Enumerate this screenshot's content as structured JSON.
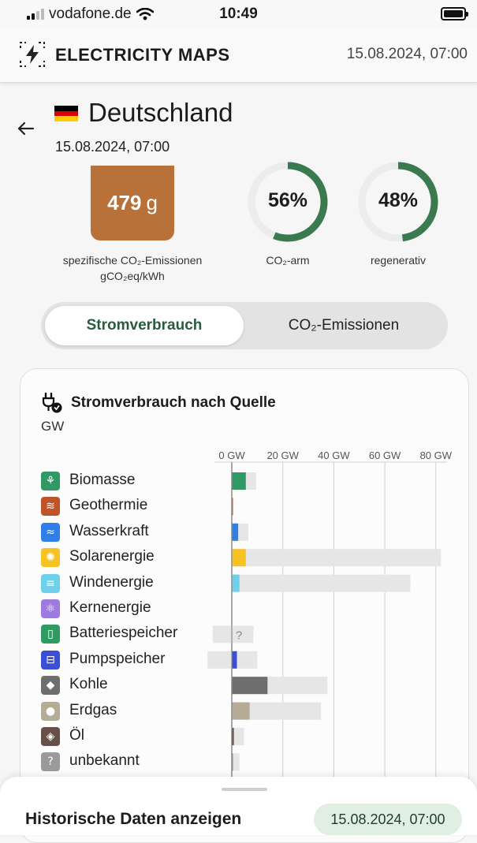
{
  "status": {
    "carrier": "vodafone.de",
    "time": "10:49"
  },
  "header": {
    "title": "ELECTRICITY MAPS",
    "datetime": "15.08.2024, 07:00"
  },
  "zone": {
    "name": "Deutschland",
    "datetime": "15.08.2024, 07:00"
  },
  "metrics": {
    "intensity_value": "479",
    "intensity_unit": "g",
    "intensity_color": "#b9713a",
    "intensity_label_line1": "spezifische CO₂-Emissionen",
    "intensity_label_line2": "gCO₂eq/kWh",
    "lowcarbon_value": "56%",
    "lowcarbon_fraction": 0.56,
    "lowcarbon_label": "CO₂-arm",
    "renewable_value": "48%",
    "renewable_fraction": 0.48,
    "renewable_label": "regenerativ",
    "ring_color": "#3b7a4f"
  },
  "toggle": {
    "active": "Stromverbrauch",
    "inactive": "CO₂-Emissionen"
  },
  "card": {
    "title": "Stromverbrauch nach Quelle",
    "unit": "GW"
  },
  "chart_data": {
    "type": "bar",
    "title": "Stromverbrauch nach Quelle",
    "ylabel": "GW",
    "xlim": [
      0,
      80
    ],
    "ticks": [
      "0 GW",
      "20 GW",
      "40 GW",
      "60 GW",
      "80 GW"
    ],
    "tick_values": [
      0,
      20,
      40,
      60,
      80
    ],
    "unknown_marker": "?",
    "rows": [
      {
        "label": "Biomasse",
        "icon": "sprout-icon",
        "color": "#2f9a63",
        "value": 5.5,
        "capacity": 9.5
      },
      {
        "label": "Geothermie",
        "icon": "heat-waves-icon",
        "color": "#c0532a",
        "value": 0.2,
        "capacity": 0.2
      },
      {
        "label": "Wasserkraft",
        "icon": "water-waves-icon",
        "color": "#2e7fe8",
        "value": 2.5,
        "capacity": 6.5
      },
      {
        "label": "Solarenergie",
        "icon": "sun-icon",
        "color": "#f6c325",
        "value": 5.5,
        "capacity": 82
      },
      {
        "label": "Windenergie",
        "icon": "wind-icon",
        "color": "#6fd0ec",
        "value": 3.0,
        "capacity": 70
      },
      {
        "label": "Kernenergie",
        "icon": "atom-icon",
        "color": "#9d7be0",
        "value": 0,
        "capacity": 0
      },
      {
        "label": "Batteriespeicher",
        "icon": "battery-icon",
        "color": "#2f9a63",
        "value": null,
        "capacity_min": -7.5,
        "capacity_max": 8.5
      },
      {
        "label": "Pumpspeicher",
        "icon": "pump-storage-icon",
        "color": "#3a4fd6",
        "value": 2.0,
        "capacity_min": -9.5,
        "capacity_max": 10.0
      },
      {
        "label": "Kohle",
        "icon": "coal-icon",
        "color": "#6e6e6e",
        "value": 14.0,
        "capacity": 37.5
      },
      {
        "label": "Erdgas",
        "icon": "gas-flame-icon",
        "color": "#b6ab95",
        "value": 7.0,
        "capacity": 35.0
      },
      {
        "label": "Öl",
        "icon": "oil-drop-icon",
        "color": "#67504a",
        "value": 0.8,
        "capacity": 4.8
      },
      {
        "label": "unbekannt",
        "icon": "question-icon",
        "color": "#9a9a9a",
        "value": 0.5,
        "capacity": 3.0
      }
    ]
  },
  "bottom_sheet": {
    "title": "Historische Daten anzeigen",
    "datetime": "15.08.2024, 07:00"
  }
}
